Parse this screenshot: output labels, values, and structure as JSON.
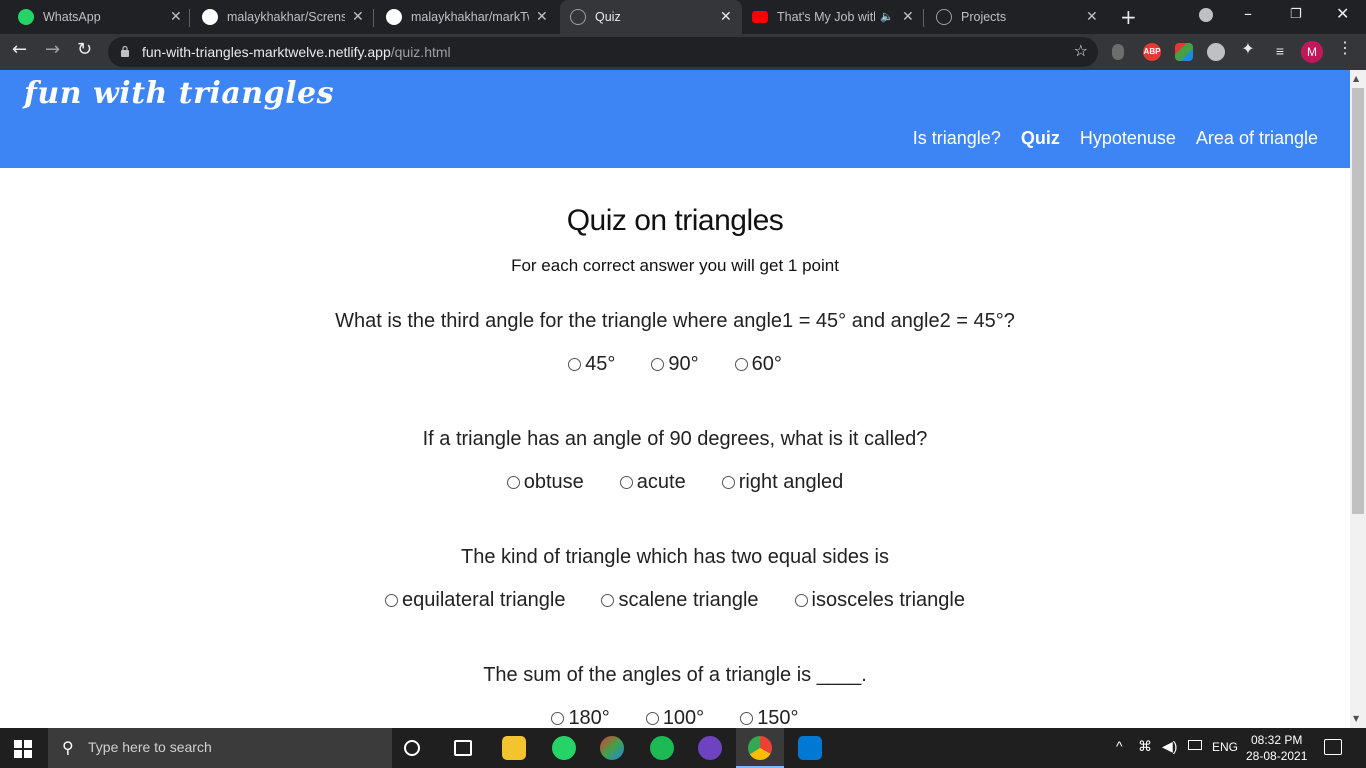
{
  "browser": {
    "tabs": [
      {
        "title": "WhatsApp",
        "favicon": "whatsapp-icon"
      },
      {
        "title": "malaykhakhar/Scrensh",
        "favicon": "github-icon"
      },
      {
        "title": "malaykhakhar/markTw",
        "favicon": "github-icon"
      },
      {
        "title": "Quiz",
        "favicon": "globe-icon"
      },
      {
        "title": "That's My Job with",
        "favicon": "youtube-icon"
      },
      {
        "title": "Projects",
        "favicon": "globe-icon"
      }
    ],
    "url_host": "fun-with-triangles-marktwelve.netlify.app",
    "url_path": "/quiz.html",
    "profile_initial": "M",
    "extension_abp": "ABP"
  },
  "site": {
    "logo": "fun with triangles",
    "nav": [
      {
        "label": "Is triangle?"
      },
      {
        "label": "Quiz"
      },
      {
        "label": "Hypotenuse"
      },
      {
        "label": "Area of triangle"
      }
    ]
  },
  "quiz": {
    "title": "Quiz on triangles",
    "subtitle": "For each correct answer you will get 1 point",
    "questions": [
      {
        "text": "What is the third angle for the triangle where angle1 = 45° and angle2 = 45°?",
        "options": [
          "45°",
          "90°",
          "60°"
        ]
      },
      {
        "text": "If a triangle has an angle of 90 degrees, what is it called?",
        "options": [
          "obtuse",
          "acute",
          "right angled"
        ]
      },
      {
        "text": "The kind of triangle which has two equal sides is",
        "options": [
          "equilateral triangle",
          "scalene triangle",
          "isosceles triangle"
        ]
      },
      {
        "text": "The sum of the angles of a triangle is ____.",
        "options": [
          "180°",
          "100°",
          "150°"
        ]
      }
    ]
  },
  "taskbar": {
    "search_placeholder": "Type here to search",
    "language": "ENG",
    "time": "08:32 PM",
    "date": "28-08-2021"
  },
  "colors": {
    "header_bg": "#3d85f5",
    "chrome_dark": "#202124",
    "chrome_toolbar": "#35363a"
  }
}
